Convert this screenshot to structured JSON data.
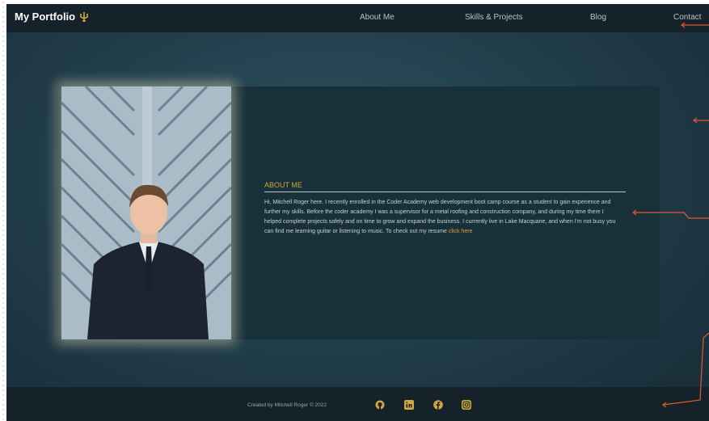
{
  "nav": {
    "brand": "My Portfolio",
    "items": [
      "About Me",
      "Skills & Projects",
      "Blog",
      "Contact"
    ]
  },
  "about": {
    "title": "ABOUT ME",
    "body": "Hi, Mitchell Roger here. I recently enrolled in the Coder Academy web development boot camp course as a student to gain experience and further my skills. Before the coder academy I was a supervisor for a metal roofing and construction company, and during my time there I helped complete projects safely and on time to grow and expand the business. I currently live in Lake Macquarie, and when I'm not busy you can find me learning guitar or listening to music. To check out my resume ",
    "link_text": "click here"
  },
  "footer": {
    "credit": "Created by Mitchell Roger © 2022",
    "social": [
      "github-icon",
      "linkedin-icon",
      "facebook-icon",
      "instagram-icon"
    ]
  },
  "colors": {
    "accent": "#d4a73a",
    "nav_bg": "#152229",
    "annotation": "#e05a33"
  }
}
